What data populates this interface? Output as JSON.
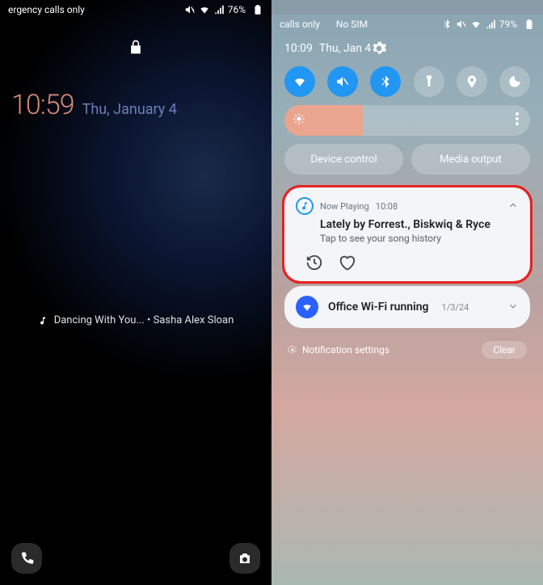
{
  "left": {
    "status": {
      "carrier": "ergency calls only",
      "battery_pct": "76%"
    },
    "clock": {
      "time": "10:59",
      "date": "Thu, January 4"
    },
    "nowplaying": "Dancing With You... • Sasha Alex Sloan"
  },
  "right": {
    "status": {
      "carrier_left": "calls only",
      "carrier_right": "No SIM",
      "battery_pct": "79%"
    },
    "shade": {
      "time": "10:09",
      "date": "Thu, Jan 4"
    },
    "qs": [
      {
        "name": "wifi-icon",
        "active": true
      },
      {
        "name": "mute-icon",
        "active": true
      },
      {
        "name": "bluetooth-icon",
        "active": true
      },
      {
        "name": "flashlight-icon",
        "active": false
      },
      {
        "name": "location-icon",
        "active": false
      },
      {
        "name": "dnd-icon",
        "active": false
      }
    ],
    "brightness_percent": 32,
    "controls": {
      "device": "Device control",
      "media": "Media output"
    },
    "card_now": {
      "app": "Now Playing",
      "time": "10:08",
      "title": "Lately by Forrest., Biskwiq & Ryce",
      "subtitle": "Tap to see your song history"
    },
    "card_wifi": {
      "title": "Office Wi-Fi running",
      "date": "1/3/24"
    },
    "notif_settings": "Notification settings",
    "clear_label": "Clear"
  }
}
